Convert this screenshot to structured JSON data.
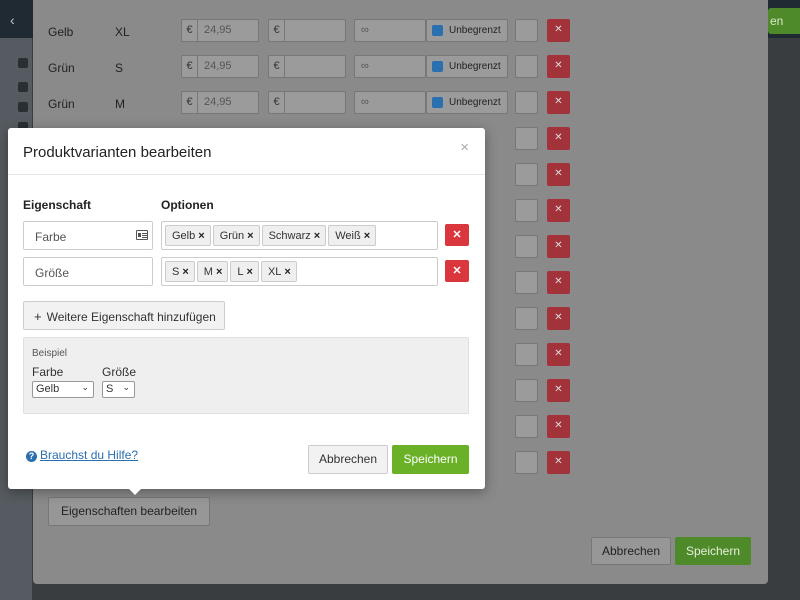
{
  "app": {
    "back_icon": "chevron-left-icon",
    "save_label": "en"
  },
  "bg_rows": [
    {
      "color": "Gelb",
      "size": "XL",
      "price": "24,95",
      "stock": "∞",
      "unlimited": "Unbegrenzt"
    },
    {
      "color": "Grün",
      "size": "S",
      "price": "24,95",
      "stock": "∞",
      "unlimited": "Unbegrenzt"
    },
    {
      "color": "Grün",
      "size": "M",
      "price": "24,95",
      "stock": "∞",
      "unlimited": "Unbegrenzt"
    }
  ],
  "bg_currency": "€",
  "bg_footer": {
    "edit_properties": "Eigenschaften bearbeiten",
    "cancel": "Abbrechen",
    "save": "Speichern"
  },
  "modal": {
    "title": "Produktvarianten bearbeiten",
    "close": "×",
    "col_property": "Eigenschaft",
    "col_options": "Optionen",
    "properties": [
      {
        "name": "Farbe",
        "options": [
          "Gelb",
          "Grün",
          "Schwarz",
          "Weiß"
        ]
      },
      {
        "name": "Größe",
        "options": [
          "S",
          "M",
          "L",
          "XL"
        ]
      }
    ],
    "add_property": "Weitere Eigenschaft hinzufügen",
    "example": {
      "title": "Beispiel",
      "fields": [
        {
          "label": "Farbe",
          "value": "Gelb"
        },
        {
          "label": "Größe",
          "value": "S"
        }
      ]
    },
    "help": "Brauchst du Hilfe?",
    "cancel": "Abbrechen",
    "save": "Speichern"
  },
  "colors": {
    "primary_green": "#6ab128",
    "danger_red": "#d9363e",
    "link_blue": "#2a6fb0"
  }
}
